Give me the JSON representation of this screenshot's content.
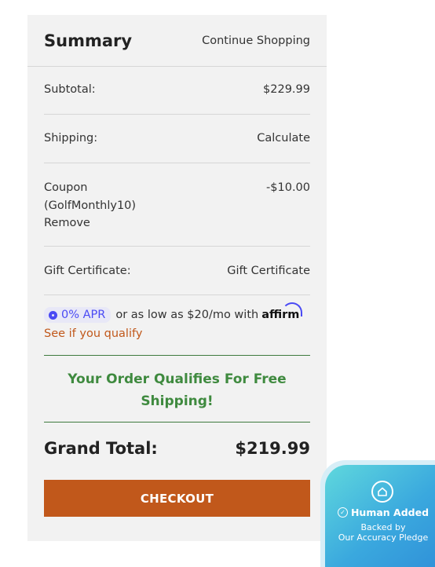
{
  "summary": {
    "title": "Summary",
    "continue_label": "Continue Shopping",
    "subtotal_label": "Subtotal:",
    "subtotal_value": "$229.99",
    "shipping_label": "Shipping:",
    "shipping_value": "Calculate",
    "coupon_label": "Coupon",
    "coupon_code": "(GolfMonthly10)",
    "coupon_remove": "Remove",
    "coupon_value": "-$10.00",
    "gift_label": "Gift Certificate:",
    "gift_value": "Gift Certificate",
    "affirm": {
      "apr": "0% APR",
      "text": "or as low as $20/mo with",
      "brand": "affirm",
      "qualify": "See if you qualify"
    },
    "free_shipping": "Your Order Qualifies For Free Shipping!",
    "grand_total_label": "Grand Total:",
    "grand_total_value": "$219.99",
    "checkout_label": "CHECKOUT"
  },
  "badge": {
    "title": "Human Added",
    "line1": "Backed by",
    "line2": "Our Accuracy Pledge"
  },
  "colors": {
    "accent": "#c1581b",
    "green": "#3f8a3f",
    "affirm_blue": "#4a4af4"
  }
}
